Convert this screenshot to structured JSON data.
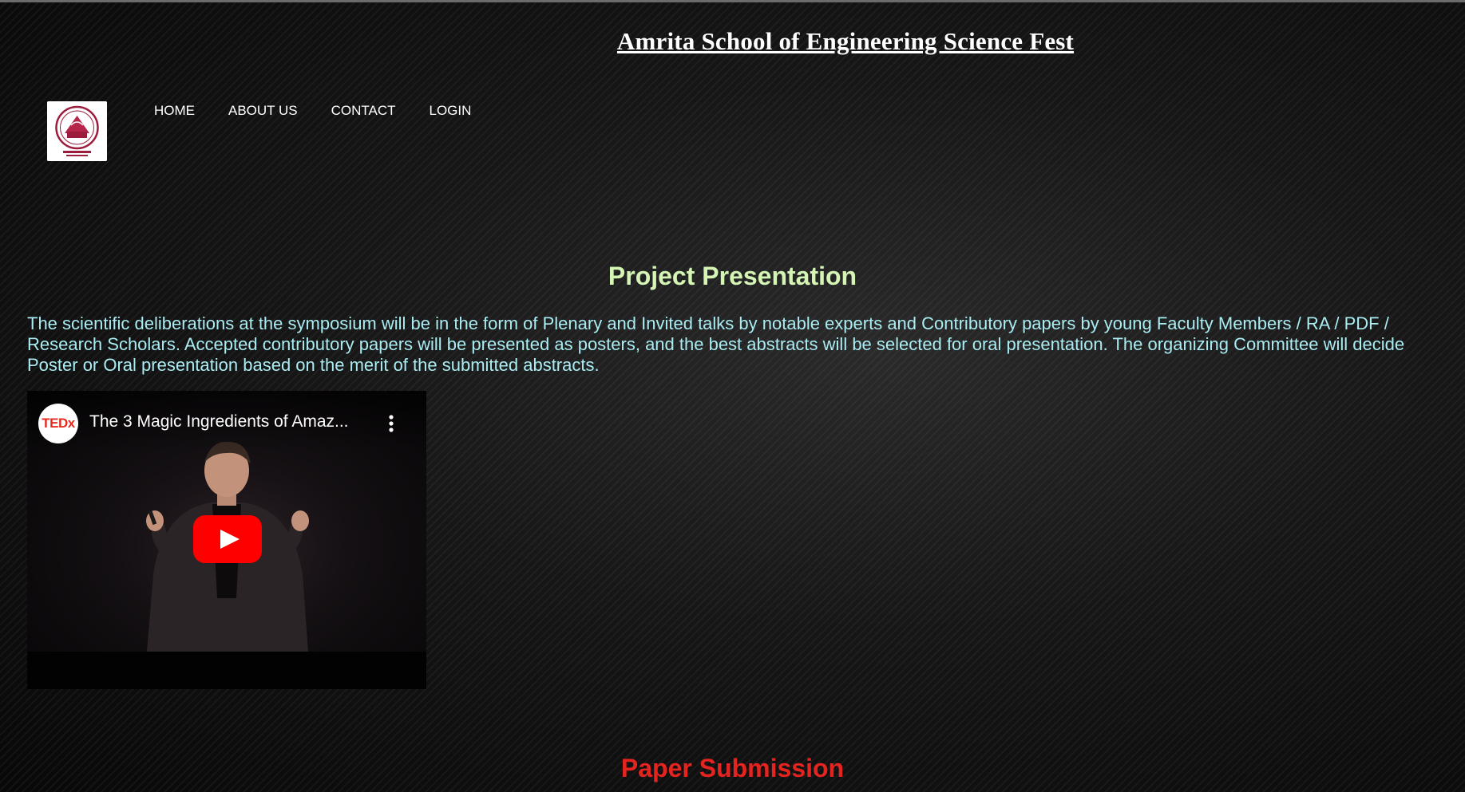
{
  "site": {
    "title": "Amrita School of Engineering Science Fest"
  },
  "nav": {
    "items": [
      {
        "label": "HOME"
      },
      {
        "label": "ABOUT US"
      },
      {
        "label": "CONTACT"
      },
      {
        "label": "LOGIN"
      }
    ]
  },
  "main": {
    "project": {
      "heading": "Project Presentation",
      "description": "The scientific deliberations at the symposium will be in the form of Plenary and Invited talks by notable experts and Contributory papers by young Faculty Members / RA / PDF / Research Scholars. Accepted contributory papers will be presented as posters, and the best abstracts will be selected for oral presentation. The organizing Committee will decide Poster or Oral presentation based on the merit of the submitted abstracts."
    },
    "video": {
      "channel_badge": "TEDx",
      "title": "The 3 Magic Ingredients of Amaz...",
      "icons": {
        "play": "play-icon",
        "more": "more-vert-icon",
        "channel": "tedx-logo-icon"
      }
    },
    "paper": {
      "heading": "Paper Submission"
    }
  },
  "colors": {
    "project_heading": "#d5f5b5",
    "description_text": "#a9ecf2",
    "paper_heading": "#e52420",
    "youtube_red": "#ff0000",
    "ted_red": "#e62b1e"
  }
}
